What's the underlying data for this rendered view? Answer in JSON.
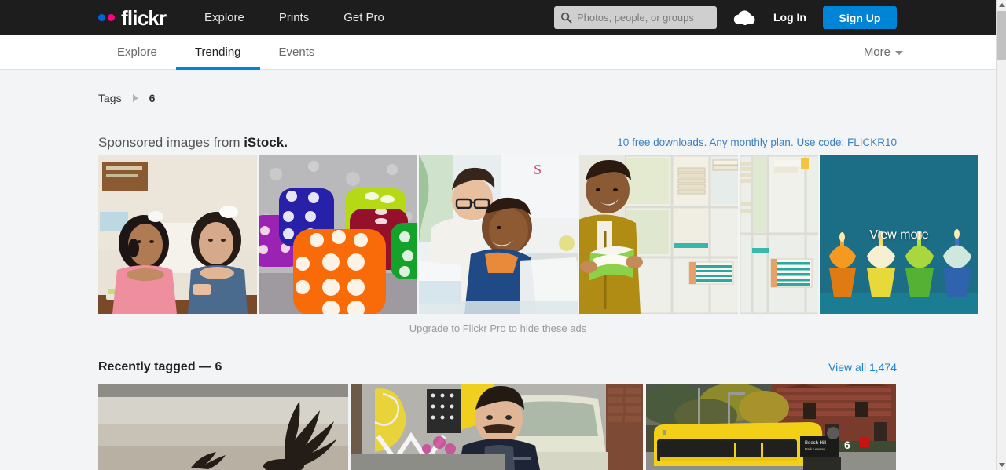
{
  "header": {
    "brand": "flickr",
    "nav": [
      {
        "label": "Explore"
      },
      {
        "label": "Prints"
      },
      {
        "label": "Get Pro"
      }
    ],
    "search": {
      "placeholder": "Photos, people, or groups",
      "value": "",
      "icon": "search-icon"
    },
    "upload_icon": "cloud-upload-icon",
    "login_label": "Log In",
    "signup_label": "Sign Up",
    "background": "#1d1d1d",
    "accent": "#0084d6"
  },
  "subnav": {
    "items": [
      {
        "label": "Explore",
        "active": false
      },
      {
        "label": "Trending",
        "active": true
      },
      {
        "label": "Events",
        "active": false
      }
    ],
    "more_label": "More",
    "active_underline_color": "#0084d6"
  },
  "breadcrumb": {
    "root_label": "Tags",
    "separator_icon": "chevron-right-icon",
    "current_label": "6"
  },
  "sponsored": {
    "heading_prefix": "Sponsored images from ",
    "heading_brand": "iStock.",
    "promo_text": "10 free downloads. Any monthly plan. Use code: FLICKR10",
    "promo_color": "#3a7fbf",
    "view_more_label": "View more",
    "upgrade_note": "Upgrade to Flickr Pro to hide these ads",
    "thumbs": [
      {
        "alt": "Two young girls in pink shirt and denim overalls reading a book at a classroom desk"
      },
      {
        "alt": "Colorful translucent dice in orange, blue, purple, red, green and yellow on a glittery surface"
      },
      {
        "alt": "Bearded teacher with glasses helping a young boy in a blue hoodie at a laptop"
      },
      {
        "alt": "Smiling boy in a mustard yellow hoodie reading a green book in a library"
      },
      {
        "alt": "White library shelves stacked with books"
      },
      {
        "alt": "Four cupcakes with lit candles in orange, yellow, green and blue on a teal background"
      }
    ]
  },
  "recently_tagged": {
    "heading": "Recently tagged — 6",
    "view_all_label": "View all 1,474",
    "view_all_color": "#1d7fd0",
    "photos": [
      {
        "alt": "Dark silhouetted bird of prey in flight over a pale snowy field"
      },
      {
        "alt": "Stylized 3D rendered man in a dark jacket standing before graffiti wall and vintage car"
      },
      {
        "alt": "Yellow city bus route 6 parked in front of red brick buildings and autumn trees"
      }
    ]
  },
  "scrollbar": {
    "up_icon": "scroll-up-arrow-icon",
    "down_icon": "scroll-down-arrow-icon"
  }
}
